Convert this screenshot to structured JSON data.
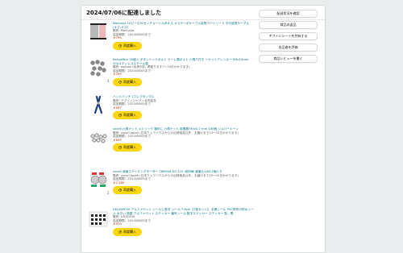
{
  "delivery_header": "2024/07/06に配達しました",
  "items": [
    {
      "title": "Mallunjia 10ピース30センチメートルJRオス-オスサーボケーブル延長コードリード 平行延長ケーブル (オス-オス)",
      "seller": "販売: Mallunjia",
      "return_window": "返品期限：2024/08/05まで",
      "price": "￥799",
      "qty": "",
      "buy_label": "再度購入",
      "icon": "servo-cable-icon"
    },
    {
      "title": "Keityoffice 50個入 ボタンヘッドボルト ドーム頭ボルト 六角穴付き ソケットアレンキー M4x10mm 304ステンレススチール製",
      "seller": "販売: bqzvan (出荷対応, 再配ります7～10日かかります)",
      "return_window": "返品期限：2024/08/05まで",
      "price": "￥399",
      "qty": "3",
      "buy_label": "再度購入",
      "icon": "bolt-icon"
    },
    {
      "title": "ハンドパンチ 1穴レクタングル",
      "seller": "販売: アマゾンジャパン合同会社",
      "return_window": "返品期限：2024/08/05まで",
      "price": "￥587",
      "qty": "",
      "buy_label": "再度購入",
      "icon": "hand-punch-icon"
    },
    {
      "title": "uxcell 六角ナット メトリック 粗めに 六角ナット 炭素鋼 M4x0.7 mm 100個 シルバートーン",
      "seller": "販売: uxcell Japan (日本ウェアハウスからの出荷商品以外、お届けまで13～15日かかります)",
      "return_window": "返品期限：2024/08/05まで",
      "price": "￥845",
      "qty": "",
      "buy_label": "再度購入",
      "icon": "hex-nut-icon"
    },
    {
      "title": "uxcell 減速ステッピングモーター 28BYJ48 DC 12V 4相5線 減速比1/64 2個入り",
      "seller": "販売: uxcell Japan (日本ウェアハウスからの出荷商品以外、お届けまで13～15日かかります)",
      "return_window": "返品期限：2024/08/05まで",
      "price": "￥2,180",
      "qty": "2",
      "buy_label": "再度購入",
      "icon": "stepper-motor-icon"
    },
    {
      "title": "DELVAEFOX アルファベット シールと数字 シール 7.6cm【7枚セット】 手帳シール PVC財布の防水シール 大きい 英語 アルファベット ステッカー 番号シール 数字ステッカー ステッカー 貼 - 黒",
      "seller": "販売: UDXFIZHI",
      "return_window": "返品期限：2024/08/05まで",
      "price": "￥970",
      "qty": "",
      "buy_label": "再度購入",
      "icon": "alphabet-sticker-icon"
    }
  ],
  "side_buttons": [
    "配送状況を確認",
    "商品の返品",
    "ギフトレシートを共有する",
    "出品者を評価",
    "商品レビューを書く"
  ],
  "colors": {
    "accent": "#ffd814",
    "link": "#007185",
    "price": "#b12704"
  }
}
